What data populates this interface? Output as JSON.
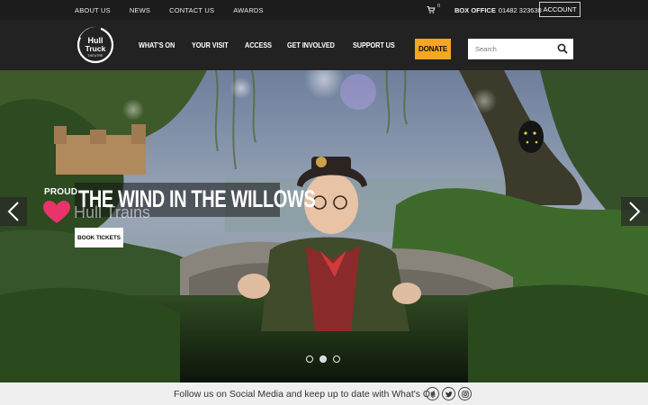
{
  "topbar": {
    "links": [
      "ABOUT US",
      "NEWS",
      "CONTACT US",
      "AWARDS"
    ],
    "cart_count": "0",
    "box_office_label": "BOX OFFICE",
    "box_office_phone": "01482 323638",
    "account_label": "ACCOUNT"
  },
  "nav": {
    "logo_alt": "Hull Truck Theatre",
    "items": [
      "WHAT'S ON",
      "YOUR VISIT",
      "ACCESS",
      "GET INVOLVED",
      "SUPPORT US"
    ],
    "donate_label": "DONATE",
    "search_placeholder": "Search"
  },
  "hero": {
    "sponsor_line1": "PROUD",
    "sponsor_line2": "Hull Trains",
    "title": "THE WIND IN THE WILLOWS",
    "cta_label": "BOOK TICKETS",
    "slide_count": 3,
    "active_slide": 2
  },
  "footer": {
    "social_text": "Follow us on Social Media and keep up to date with What's On",
    "social_icons": [
      "facebook-icon",
      "twitter-icon",
      "instagram-icon"
    ]
  },
  "colors": {
    "accent": "#f5a623",
    "topbar_bg": "#1c1c1c",
    "nav_bg": "#222222",
    "heart": "#e8336b"
  }
}
